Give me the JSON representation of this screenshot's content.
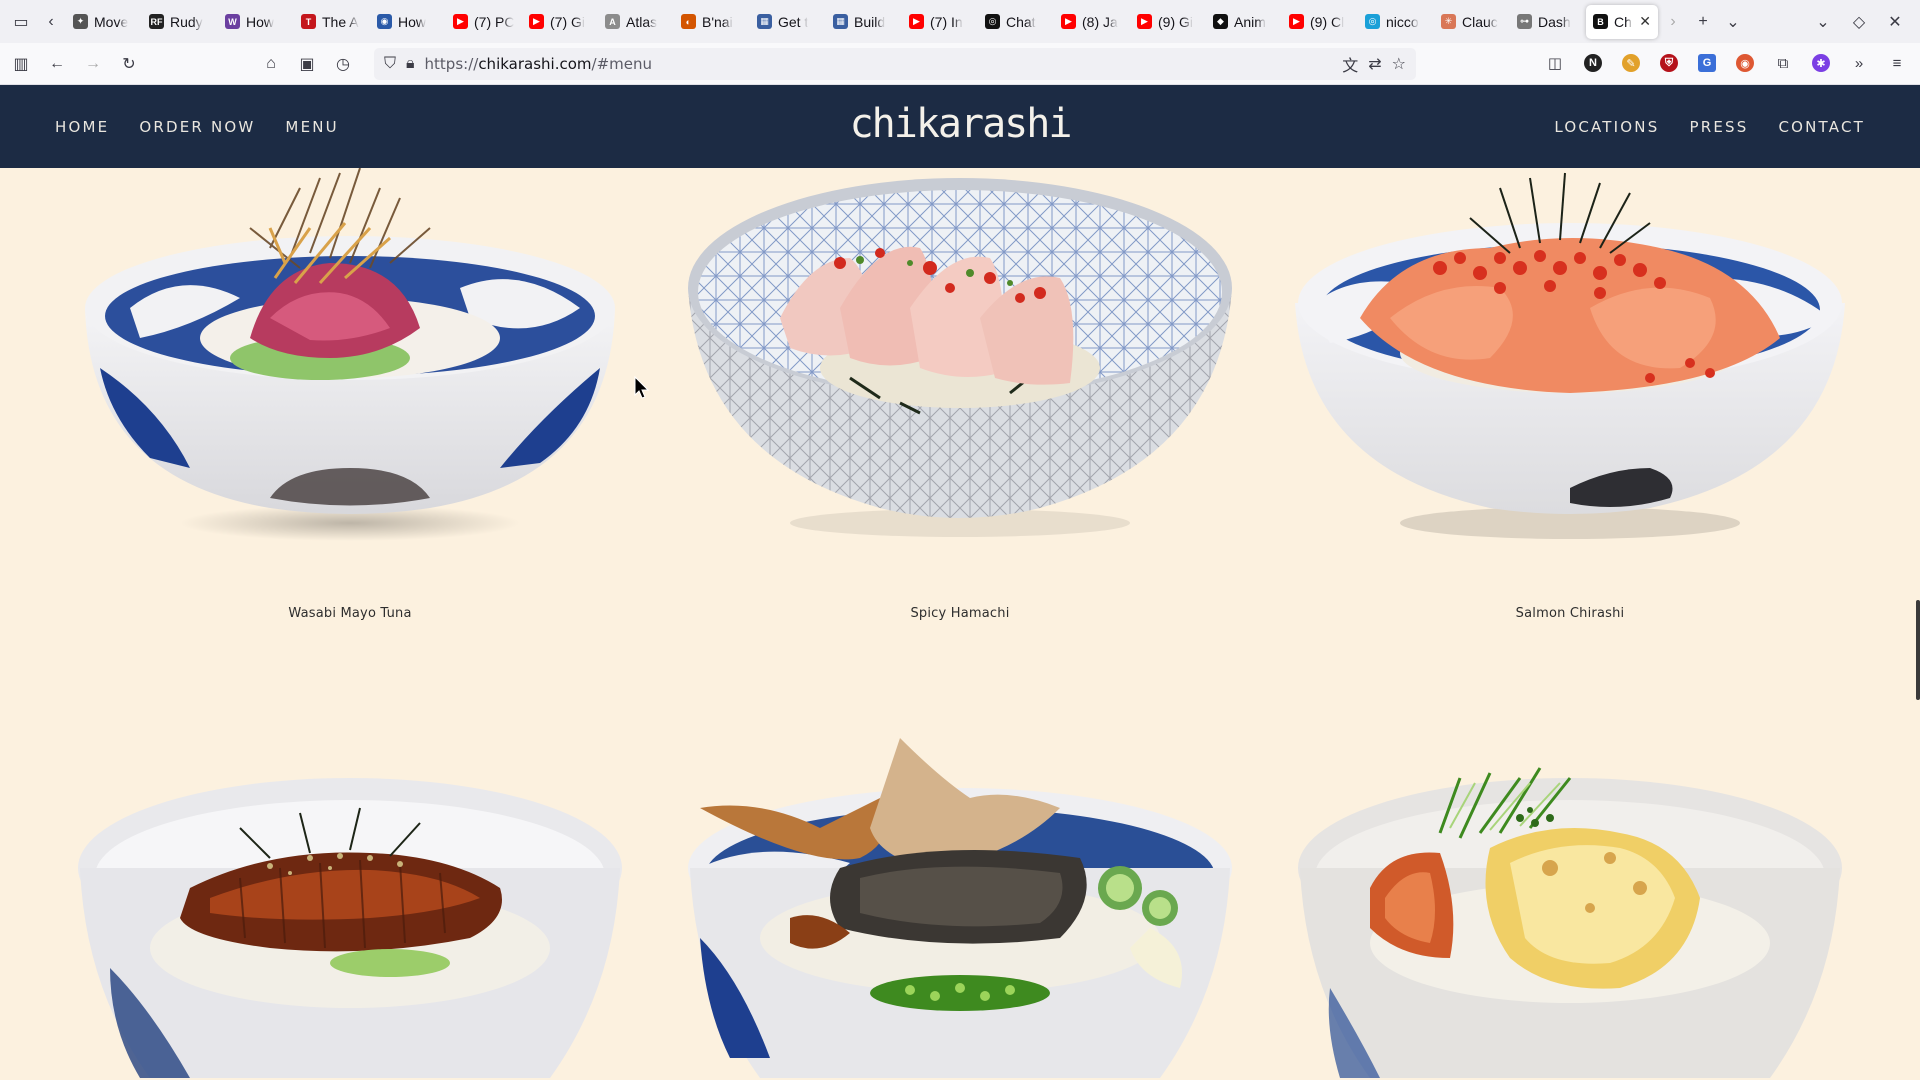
{
  "browser": {
    "tabs": [
      {
        "label": "Move",
        "fav_color": "#555",
        "fav_char": "✦"
      },
      {
        "label": "Rudy",
        "fav_color": "#222",
        "fav_char": "RF"
      },
      {
        "label": "How",
        "fav_color": "#6b3fa0",
        "fav_char": "W"
      },
      {
        "label": "The A",
        "fav_color": "#c4161c",
        "fav_char": "T"
      },
      {
        "label": "How",
        "fav_color": "#2b5aa8",
        "fav_char": "◉"
      },
      {
        "label": "(7) PC",
        "fav_color": "#ff0000",
        "fav_char": "▶"
      },
      {
        "label": "(7) Gi",
        "fav_color": "#ff0000",
        "fav_char": "▶"
      },
      {
        "label": "Atlas",
        "fav_color": "#8c8c8c",
        "fav_char": "A"
      },
      {
        "label": "B'nai",
        "fav_color": "#d35400",
        "fav_char": "◐"
      },
      {
        "label": "Get t",
        "fav_color": "#3a5fa0",
        "fav_char": "▦"
      },
      {
        "label": "Build",
        "fav_color": "#3a5fa0",
        "fav_char": "▦"
      },
      {
        "label": "(7) In",
        "fav_color": "#ff0000",
        "fav_char": "▶"
      },
      {
        "label": "Chat",
        "fav_color": "#111",
        "fav_char": "◎"
      },
      {
        "label": "(8) Ja",
        "fav_color": "#ff0000",
        "fav_char": "▶"
      },
      {
        "label": "(9) Gi",
        "fav_color": "#ff0000",
        "fav_char": "▶"
      },
      {
        "label": "Anim",
        "fav_color": "#111",
        "fav_char": "◆"
      },
      {
        "label": "(9) Cl",
        "fav_color": "#ff0000",
        "fav_char": "▶"
      },
      {
        "label": "nicco",
        "fav_color": "#1aa0d8",
        "fav_char": "◎"
      },
      {
        "label": "Clauc",
        "fav_color": "#d97757",
        "fav_char": "✳"
      },
      {
        "label": "Dash",
        "fav_color": "#777",
        "fav_char": "⊶"
      },
      {
        "label": "Ch",
        "fav_color": "#111",
        "fav_char": "B",
        "active": true
      }
    ],
    "url_prefix": "https://",
    "url_domain": "chikarashi.com",
    "url_path": "/#menu"
  },
  "site": {
    "logo": "chikarashi",
    "nav_left": [
      "HOME",
      "ORDER NOW",
      "MENU"
    ],
    "nav_right": [
      "LOCATIONS",
      "PRESS",
      "CONTACT"
    ]
  },
  "menu": {
    "items": [
      {
        "name": "Wasabi Mayo Tuna",
        "bowl": "blue-swirl",
        "topping": "tuna"
      },
      {
        "name": "Spicy Hamachi",
        "bowl": "asanoha",
        "topping": "hamachi"
      },
      {
        "name": "Salmon Chirashi",
        "bowl": "blue-swirl",
        "topping": "salmon"
      },
      {
        "name": "",
        "bowl": "white",
        "topping": "unagi"
      },
      {
        "name": "",
        "bowl": "blue-swirl",
        "topping": "fish-collar"
      },
      {
        "name": "",
        "bowl": "white",
        "topping": "miso-cod"
      }
    ]
  },
  "colors": {
    "page_bg": "#fcf1df",
    "header_bg": "#1c2b44",
    "header_text": "#e9e6df"
  }
}
